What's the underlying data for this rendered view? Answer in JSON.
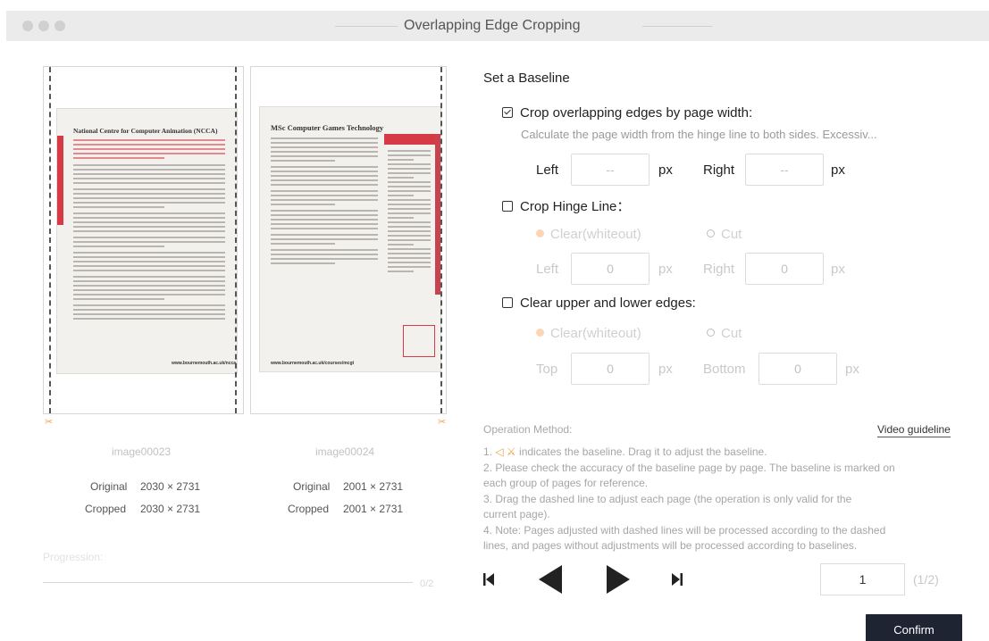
{
  "window": {
    "title": "Overlapping Edge Cropping"
  },
  "preview": {
    "images": [
      {
        "name": "image00023",
        "heading": "National Centre for Computer Animation (NCCA)",
        "footer_url": "www.bournemouth.ac.uk/ncca",
        "original_label": "Original",
        "original": "2030 × 2731",
        "cropped_label": "Cropped",
        "cropped": "2030 × 2731"
      },
      {
        "name": "image00024",
        "heading": "MSc Computer Games Technology",
        "footer_url": "www.bournemouth.ac.uk/courses/mcgt",
        "original_label": "Original",
        "original": "2001 × 2731",
        "cropped_label": "Cropped",
        "cropped": "2001 × 2731"
      }
    ],
    "progress": {
      "label": "Progression:",
      "count": "0/2",
      "fraction": 0
    }
  },
  "settings": {
    "title": "Set a Baseline",
    "crop_width": {
      "label": "Crop overlapping edges by page width:",
      "checked": true,
      "description": "Calculate the page width from the hinge line to both sides. Excessiv...",
      "left_label": "Left",
      "left_value": "--",
      "right_label": "Right",
      "right_value": "--",
      "unit": "px"
    },
    "crop_hinge": {
      "label": "Crop Hinge Line：",
      "checked": false,
      "option_clear": "Clear(whiteout)",
      "option_cut": "Cut",
      "left_label": "Left",
      "left_value": "0",
      "right_label": "Right",
      "right_value": "0",
      "unit": "px"
    },
    "clear_edges": {
      "label": "Clear upper and lower edges:",
      "checked": false,
      "option_clear": "Clear(whiteout)",
      "option_cut": "Cut",
      "top_label": "Top",
      "top_value": "0",
      "bottom_label": "Bottom",
      "bottom_value": "0",
      "unit": "px"
    }
  },
  "operation": {
    "title": "Operation Method:",
    "video_link": "Video guideline",
    "step1_prefix": "1.",
    "step1_icon": "◁ ⚔",
    "step1_text": "indicates the baseline. Drag it to adjust the baseline.",
    "step2a": "2. Please check the accuracy of the baseline page by page. The baseline is marked on",
    "step2b": "each group of pages for reference.",
    "step3a": "3. Drag the dashed line to adjust each page (the operation is only valid for the",
    "step3b": "current page).",
    "step4a": "4. Note: Pages adjusted with dashed lines will be processed according to the dashed",
    "step4b": "lines, and pages without adjustments will be processed according to baselines."
  },
  "navigation": {
    "page": "1",
    "total": "(1/2)",
    "confirm_label": "Confirm"
  },
  "colors": {
    "accent": "#f0a24a",
    "confirm_bg": "#1f2433",
    "page_red": "#d63a45"
  },
  "icons": [
    "first-page-icon",
    "previous-icon",
    "next-icon",
    "last-page-icon",
    "scissors-icon",
    "checkbox-icon",
    "radio-icon"
  ]
}
